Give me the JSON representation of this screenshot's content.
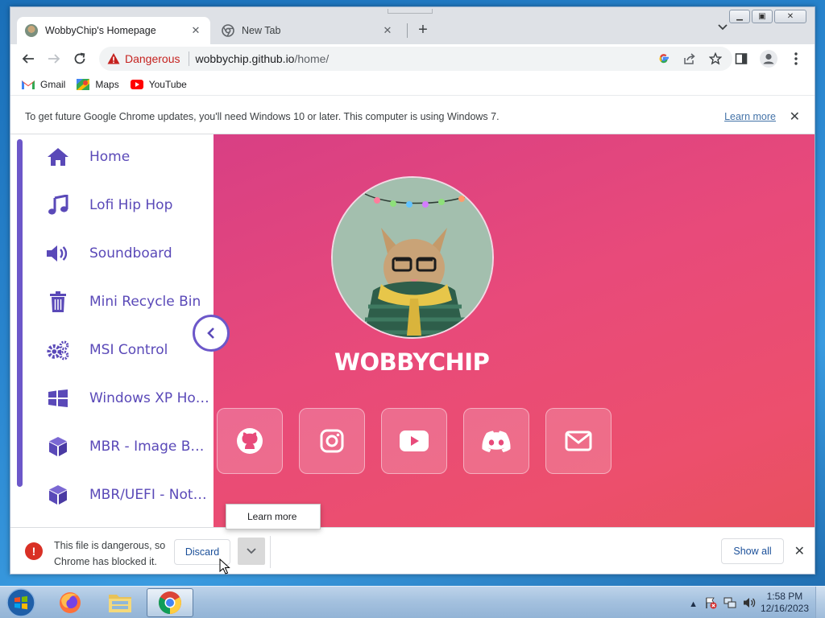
{
  "browser": {
    "tabs": [
      {
        "title": "WobbyChip's Homepage",
        "active": true
      },
      {
        "title": "New Tab",
        "active": false
      }
    ],
    "omnibox": {
      "security_label": "Dangerous",
      "url_host": "wobbychip.github.io",
      "url_path": "/home/"
    },
    "bookmarks": [
      {
        "label": "Gmail",
        "icon": "gmail-icon"
      },
      {
        "label": "Maps",
        "icon": "maps-icon"
      },
      {
        "label": "YouTube",
        "icon": "youtube-icon"
      }
    ],
    "infobar": {
      "message": "To get future Google Chrome updates, you'll need Windows 10 or later. This computer is using Windows 7.",
      "link": "Learn more"
    }
  },
  "page": {
    "sidebar": {
      "items": [
        {
          "label": "Home",
          "icon": "home-icon"
        },
        {
          "label": "Lofi Hip Hop",
          "icon": "music-note-icon"
        },
        {
          "label": "Soundboard",
          "icon": "speaker-icon"
        },
        {
          "label": "Mini Recycle Bin",
          "icon": "trash-icon"
        },
        {
          "label": "MSI Control",
          "icon": "gears-icon"
        },
        {
          "label": "Windows XP Ho…",
          "icon": "windows-icon"
        },
        {
          "label": "MBR - Image B…",
          "icon": "cube-icon"
        },
        {
          "label": "MBR/UEFI - Not…",
          "icon": "cube-icon"
        }
      ]
    },
    "hero": {
      "name": "WOBBYCHIP",
      "socials": [
        "github-icon",
        "instagram-icon",
        "youtube-icon",
        "discord-icon",
        "mail-icon"
      ]
    }
  },
  "popup": {
    "label": "Learn more"
  },
  "download_shelf": {
    "message": "This file is dangerous, so Chrome has blocked it.",
    "discard_label": "Discard",
    "show_all_label": "Show all"
  },
  "taskbar": {
    "time": "1:58 PM",
    "date": "12/16/2023"
  },
  "colors": {
    "sidebar_accent": "#6c57c9",
    "hero_gradient_start": "#d83f84",
    "hero_gradient_end": "#e8505e",
    "danger": "#c5221f"
  }
}
